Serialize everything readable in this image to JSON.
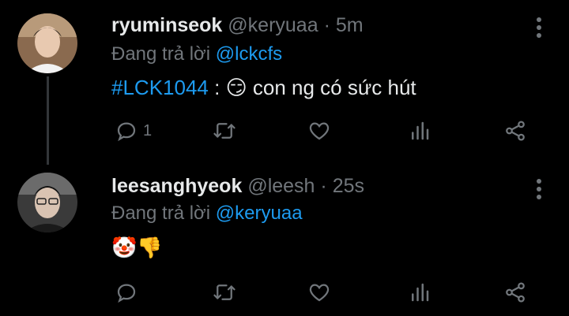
{
  "tweets": [
    {
      "name": "ryuminseok",
      "handle": "@keryuaa",
      "separator": "·",
      "time": "5m",
      "reply_prefix": "Đang trả lời",
      "reply_to": "@lckcfs",
      "hashtag": "#LCK1044",
      "body_colon": " : ",
      "emoji": "😏",
      "body_text": " con ng có sức hút",
      "reply_count": "1"
    },
    {
      "name": "leesanghyeok",
      "handle": "@leesh",
      "separator": "·",
      "time": "25s",
      "reply_prefix": "Đang trả lời",
      "reply_to": "@keryuaa",
      "emojis": "🤡👎"
    }
  ],
  "colors": {
    "background": "#000000",
    "text": "#e7e9ea",
    "muted": "#71767b",
    "accent": "#1d9bf0",
    "thread_line": "#333639"
  },
  "icons": [
    "reply-icon",
    "retweet-icon",
    "like-icon",
    "views-icon",
    "share-icon",
    "more-icon"
  ]
}
